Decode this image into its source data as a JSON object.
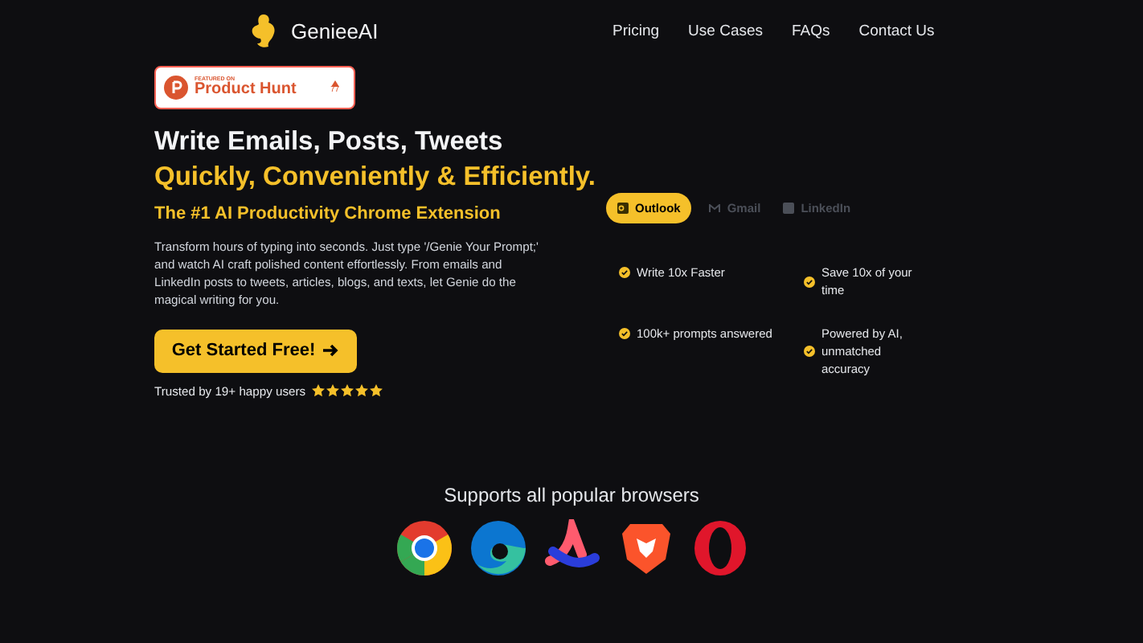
{
  "header": {
    "brand": "GenieeAI",
    "nav": [
      "Pricing",
      "Use Cases",
      "FAQs",
      "Contact Us"
    ]
  },
  "badge": {
    "caption": "FEATURED ON",
    "name": "Product Hunt",
    "votes": "77"
  },
  "hero": {
    "headline": "Write Emails, Posts, Tweets",
    "highlight": "Quickly, Conveniently & Efficiently.",
    "subtitle": "The #1 AI Productivity Chrome Extension",
    "description": "Transform hours of typing into seconds. Just type '/Genie Your Prompt;' and watch AI craft polished content effortlessly. From emails and LinkedIn posts to tweets, articles, blogs, and texts, let Genie do the magical writing for you.",
    "cta": "Get Started Free!",
    "trust": "Trusted by 19+ happy users",
    "stars": 5
  },
  "tabs": [
    {
      "label": "Outlook",
      "kind": "outlook",
      "selected": true
    },
    {
      "label": "Gmail",
      "kind": "gmail",
      "selected": false
    },
    {
      "label": "LinkedIn",
      "kind": "linkedin",
      "selected": false
    }
  ],
  "features": [
    "Write 10x Faster",
    "Save 10x of your time",
    "100k+ prompts answered",
    "Powered by AI, unmatched accuracy"
  ],
  "browsers": {
    "title": "Supports all popular browsers",
    "items": [
      {
        "kind": "chrome"
      },
      {
        "kind": "edge"
      },
      {
        "kind": "arc"
      },
      {
        "kind": "brave"
      },
      {
        "kind": "opera"
      }
    ]
  }
}
